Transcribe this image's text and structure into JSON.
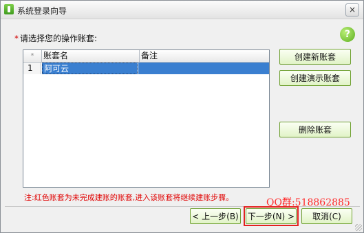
{
  "window": {
    "title": "系统登录向导",
    "close_glyph": "×",
    "app_icon": "app-logo-icon"
  },
  "prompt": {
    "required_mark": "*",
    "text": "请选择您的操作账套:"
  },
  "help": {
    "glyph": "?",
    "icon": "help-icon"
  },
  "table": {
    "row_index_header": "*",
    "columns": [
      "账套名",
      "备注"
    ],
    "rows": [
      {
        "index": "1",
        "name": "阿可云",
        "remark": ""
      }
    ]
  },
  "side_buttons": {
    "create_new": "创建新账套",
    "create_demo": "创建演示账套",
    "delete": "删除账套"
  },
  "note": "注:红色账套为未完成建账的账套,进入该账套将继续建账步骤。",
  "watermark": "QQ群:518862885",
  "footer": {
    "prev": "< 上一步(B)",
    "next": "下一步(N) >",
    "cancel": "取消(C)"
  },
  "colors": {
    "accent": "#3a7fd0",
    "button_border": "#6fa032",
    "highlight_box": "#e3221f",
    "note_text": "#e00000"
  }
}
